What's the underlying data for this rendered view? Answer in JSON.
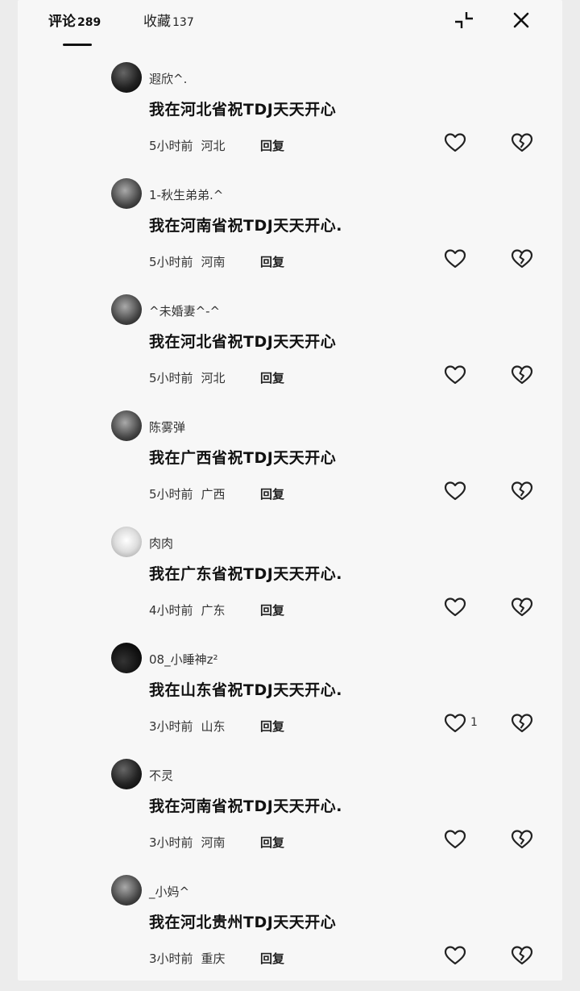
{
  "header": {
    "tab_comments": "评论",
    "comment_count": "289",
    "tab_favorites": "收藏",
    "favorite_count": "137"
  },
  "comments": [
    {
      "user": "遐欣^.",
      "text": "我在河北省祝TDJ天天开心",
      "time": "5小时前",
      "location": "河北",
      "reply": "回复",
      "likes": ""
    },
    {
      "user": "1-秋生弟弟.^",
      "text": "我在河南省祝TDJ天天开心.",
      "time": "5小时前",
      "location": "河南",
      "reply": "回复",
      "likes": ""
    },
    {
      "user": "^未婚妻^-^",
      "text": "我在河北省祝TDJ天天开心",
      "time": "5小时前",
      "location": "河北",
      "reply": "回复",
      "likes": ""
    },
    {
      "user": "陈雾弹",
      "text": "我在广西省祝TDJ天天开心",
      "time": "5小时前",
      "location": "广西",
      "reply": "回复",
      "likes": ""
    },
    {
      "user": "肉肉",
      "text": "我在广东省祝TDJ天天开心.",
      "time": "4小时前",
      "location": "广东",
      "reply": "回复",
      "likes": ""
    },
    {
      "user": "08_小睡神z²",
      "text": "我在山东省祝TDJ天天开心.",
      "time": "3小时前",
      "location": "山东",
      "reply": "回复",
      "likes": "1"
    },
    {
      "user": "不灵",
      "text": "我在河南省祝TDJ天天开心.",
      "time": "3小时前",
      "location": "河南",
      "reply": "回复",
      "likes": ""
    },
    {
      "user": "_小妈^",
      "text": "我在河北贵州TDJ天天开心",
      "time": "3小时前",
      "location": "重庆",
      "reply": "回复",
      "likes": ""
    }
  ]
}
